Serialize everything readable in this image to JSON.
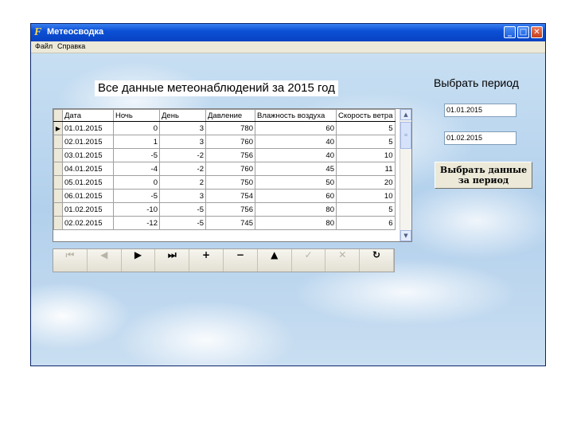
{
  "window": {
    "title": "Метеосводка",
    "controls": {
      "minimize": "_",
      "maximize": "□",
      "close": "✕"
    }
  },
  "menu": [
    "Файл",
    "Справка"
  ],
  "page_title": "Все данные метеонаблюдений за 2015 год",
  "period": {
    "label": "Выбрать период",
    "from": "01.01.2015",
    "to": "01.02.2015",
    "button": [
      "Выбрать данные",
      "за период"
    ]
  },
  "grid": {
    "columns": [
      "Дата",
      "Ночь",
      "День",
      "Давление",
      "Влажность воздуха",
      "Скорость ветра"
    ],
    "current_row_marker": "▶",
    "rows": [
      [
        "01.01.2015",
        "0",
        "3",
        "780",
        "60",
        "5"
      ],
      [
        "02.01.2015",
        "1",
        "3",
        "760",
        "40",
        "5"
      ],
      [
        "03.01.2015",
        "-5",
        "-2",
        "756",
        "40",
        "10"
      ],
      [
        "04.01.2015",
        "-4",
        "-2",
        "760",
        "45",
        "11"
      ],
      [
        "05.01.2015",
        "0",
        "2",
        "750",
        "50",
        "20"
      ],
      [
        "06.01.2015",
        "-5",
        "3",
        "754",
        "60",
        "10"
      ],
      [
        "01.02.2015",
        "-10",
        "-5",
        "756",
        "80",
        "5"
      ],
      [
        "02.02.2015",
        "-12",
        "-5",
        "745",
        "80",
        "6"
      ]
    ],
    "scrollbar": {
      "up": "▲",
      "down": "▼",
      "thumb": "≡"
    }
  },
  "navigator": [
    {
      "name": "first",
      "glyph": "⏮",
      "enabled": false
    },
    {
      "name": "prior",
      "glyph": "◀",
      "enabled": false
    },
    {
      "name": "next",
      "glyph": "▶",
      "enabled": true
    },
    {
      "name": "last",
      "glyph": "⏭",
      "enabled": true
    },
    {
      "name": "insert",
      "glyph": "+",
      "enabled": true
    },
    {
      "name": "delete",
      "glyph": "−",
      "enabled": true
    },
    {
      "name": "edit",
      "glyph": "▲",
      "enabled": true
    },
    {
      "name": "post",
      "glyph": "✓",
      "enabled": false
    },
    {
      "name": "cancel",
      "glyph": "✕",
      "enabled": false
    },
    {
      "name": "refresh",
      "glyph": "↻",
      "enabled": true
    }
  ],
  "colors": {
    "titlebar": "#0c50d6",
    "chrome": "#ece9d8",
    "sky": "#b2d0ec"
  }
}
